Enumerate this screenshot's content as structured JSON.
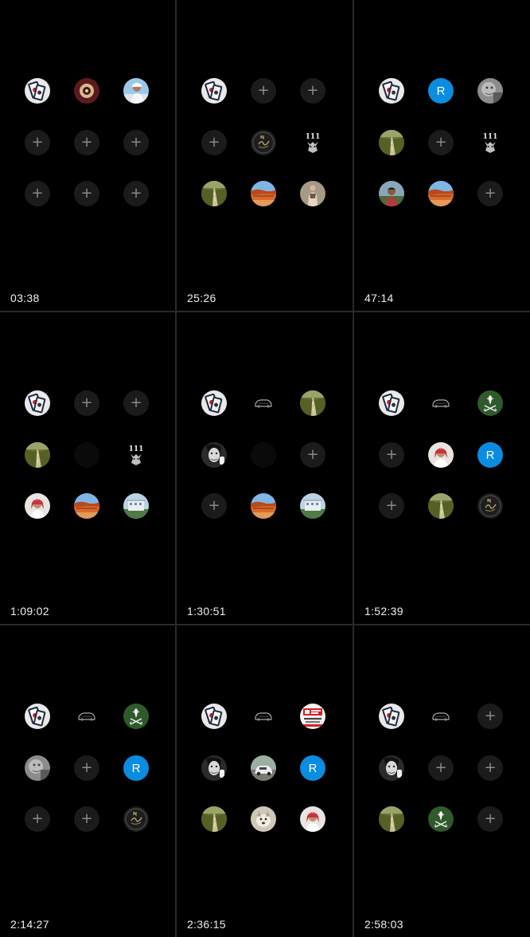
{
  "panels": [
    {
      "time": "03:38",
      "seats": [
        "avatar-cards",
        "avatar-maroon",
        "avatar-man-sky",
        "empty",
        "empty",
        "empty",
        "empty",
        "empty",
        "empty"
      ]
    },
    {
      "time": "25:26",
      "seats": [
        "avatar-cards",
        "empty",
        "empty",
        "empty",
        "avatar-dark-logo",
        "avatar-111",
        "avatar-road",
        "avatar-desert",
        "avatar-figure"
      ]
    },
    {
      "time": "47:14",
      "seats": [
        "avatar-cards",
        "letter-R",
        "avatar-grey-face",
        "avatar-road",
        "empty",
        "avatar-111",
        "avatar-man-field",
        "avatar-desert",
        "empty"
      ]
    },
    {
      "time": "1:09:02",
      "seats": [
        "avatar-cards",
        "empty",
        "empty",
        "avatar-road",
        "blank",
        "avatar-111",
        "avatar-man-shemagh",
        "avatar-desert",
        "avatar-building"
      ]
    },
    {
      "time": "1:30:51",
      "seats": [
        "avatar-cards",
        "avatar-car-logo",
        "avatar-road",
        "avatar-bw-face",
        "blank",
        "empty",
        "empty",
        "avatar-desert",
        "avatar-building"
      ]
    },
    {
      "time": "1:52:39",
      "seats": [
        "avatar-cards",
        "avatar-car-logo",
        "avatar-saudi-emblem",
        "empty",
        "avatar-man-shemagh",
        "letter-R",
        "empty",
        "avatar-road",
        "avatar-dark-logo"
      ]
    },
    {
      "time": "2:14:27",
      "seats": [
        "avatar-cards",
        "avatar-car-logo",
        "avatar-saudi-emblem",
        "avatar-grey-face",
        "empty",
        "letter-R",
        "empty",
        "empty",
        "avatar-dark-logo"
      ]
    },
    {
      "time": "2:36:15",
      "seats": [
        "avatar-cards",
        "avatar-car-logo",
        "avatar-red-sign",
        "avatar-bw-face",
        "avatar-car-photo",
        "letter-R",
        "avatar-road",
        "avatar-dog",
        "avatar-man-shemagh"
      ]
    },
    {
      "time": "2:58:03",
      "seats": [
        "avatar-cards",
        "avatar-car-logo",
        "empty",
        "avatar-bw-face",
        "empty",
        "empty",
        "avatar-road",
        "avatar-saudi-emblem",
        "empty"
      ]
    }
  ],
  "letter_avatar": "R",
  "plus_glyph": "+",
  "colors": {
    "background": "#000000",
    "divider": "#2a2a2a",
    "empty_seat": "#1b1b1b",
    "letter_avatar": "#0a8de0",
    "timer_text": "#f0f0f0"
  }
}
